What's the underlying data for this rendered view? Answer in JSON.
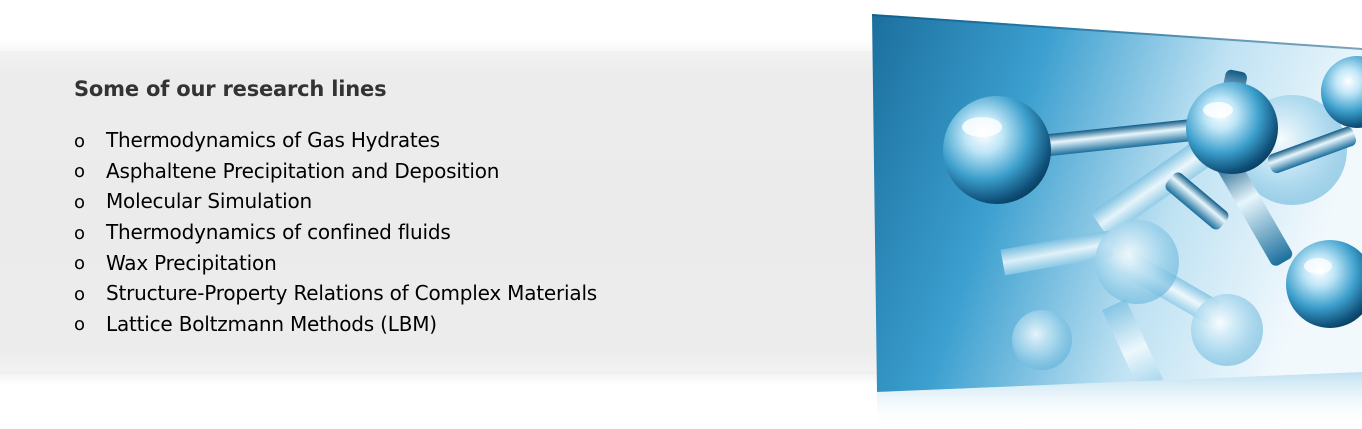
{
  "section": {
    "title": "Some of our research lines",
    "items": [
      {
        "label": "Thermodynamics of Gas Hydrates"
      },
      {
        "label": "Asphaltene Precipitation and Deposition"
      },
      {
        "label": "Molecular Simulation"
      },
      {
        "label": "Thermodynamics of confined fluids"
      },
      {
        "label": "Wax Precipitation"
      },
      {
        "label": "Structure-Property Relations of Complex Materials"
      },
      {
        "label": "Lattice Boltzmann Methods (LBM)"
      }
    ],
    "bullet": "o"
  },
  "image": {
    "icon": "molecule-image",
    "colors": {
      "deep": "#1a6f9e",
      "mid": "#3aa0cf",
      "light": "#cfe9f6"
    }
  }
}
